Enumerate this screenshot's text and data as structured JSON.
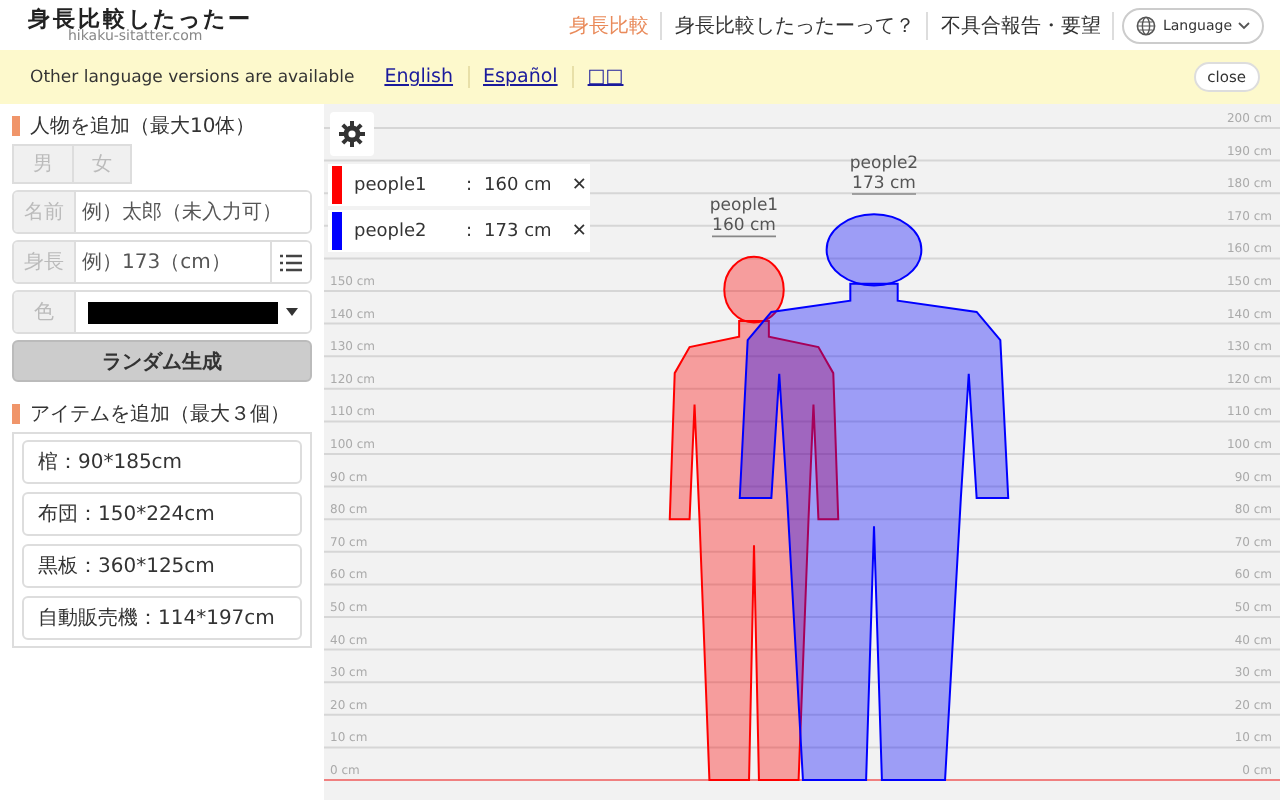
{
  "header": {
    "title": "身長比較したったー",
    "subtitle": "hikaku-sitatter.com",
    "nav": [
      {
        "label": "身長比較",
        "selected": true
      },
      {
        "label": "身長比較したったーって？",
        "selected": false
      },
      {
        "label": "不具合報告・要望",
        "selected": false
      }
    ],
    "language_button": "Language"
  },
  "banner": {
    "message": "Other language versions are available",
    "links": [
      "English",
      "Español",
      "□□"
    ],
    "close": "close"
  },
  "sidebar": {
    "person_section": {
      "heading": "人物を追加（最大10体）",
      "gender_buttons": [
        "男",
        "女"
      ],
      "name_field": {
        "label": "名前",
        "placeholder": "例）太郎（未入力可）"
      },
      "height_field": {
        "label": "身長",
        "placeholder": "例）173（cm）"
      },
      "color_field": {
        "label": "色",
        "color": "#000000"
      },
      "random_button": "ランダム生成"
    },
    "item_section": {
      "heading": "アイテムを追加（最大３個）",
      "items": [
        "棺：90*185cm",
        "布団：150*224cm",
        "黒板：360*125cm",
        "自動販売機：114*197cm"
      ]
    }
  },
  "chart": {
    "scale_left": [
      "150 cm",
      "140 cm",
      "130 cm",
      "120 cm",
      "110 cm",
      "100 cm",
      "90 cm",
      "80 cm",
      "70 cm",
      "60 cm",
      "50 cm",
      "40 cm",
      "30 cm",
      "20 cm",
      "10 cm",
      "0 cm"
    ],
    "scale_right": [
      "200 cm",
      "190 cm",
      "180 cm",
      "170 cm",
      "160 cm",
      "150 cm",
      "140 cm",
      "130 cm",
      "120 cm",
      "110 cm",
      "100 cm",
      "90 cm",
      "80 cm",
      "70 cm",
      "60 cm",
      "50 cm",
      "40 cm",
      "30 cm",
      "20 cm",
      "10 cm",
      "0 cm"
    ],
    "people": [
      {
        "name": "people1",
        "separator": ":",
        "height": "160 cm",
        "color": "#ff0000"
      },
      {
        "name": "people2",
        "separator": ":",
        "height": "173 cm",
        "color": "#0000ff"
      }
    ],
    "figures": [
      {
        "name": "people1",
        "height": "160 cm"
      },
      {
        "name": "people2",
        "height": "173 cm"
      }
    ],
    "remove_icon": "✕"
  }
}
